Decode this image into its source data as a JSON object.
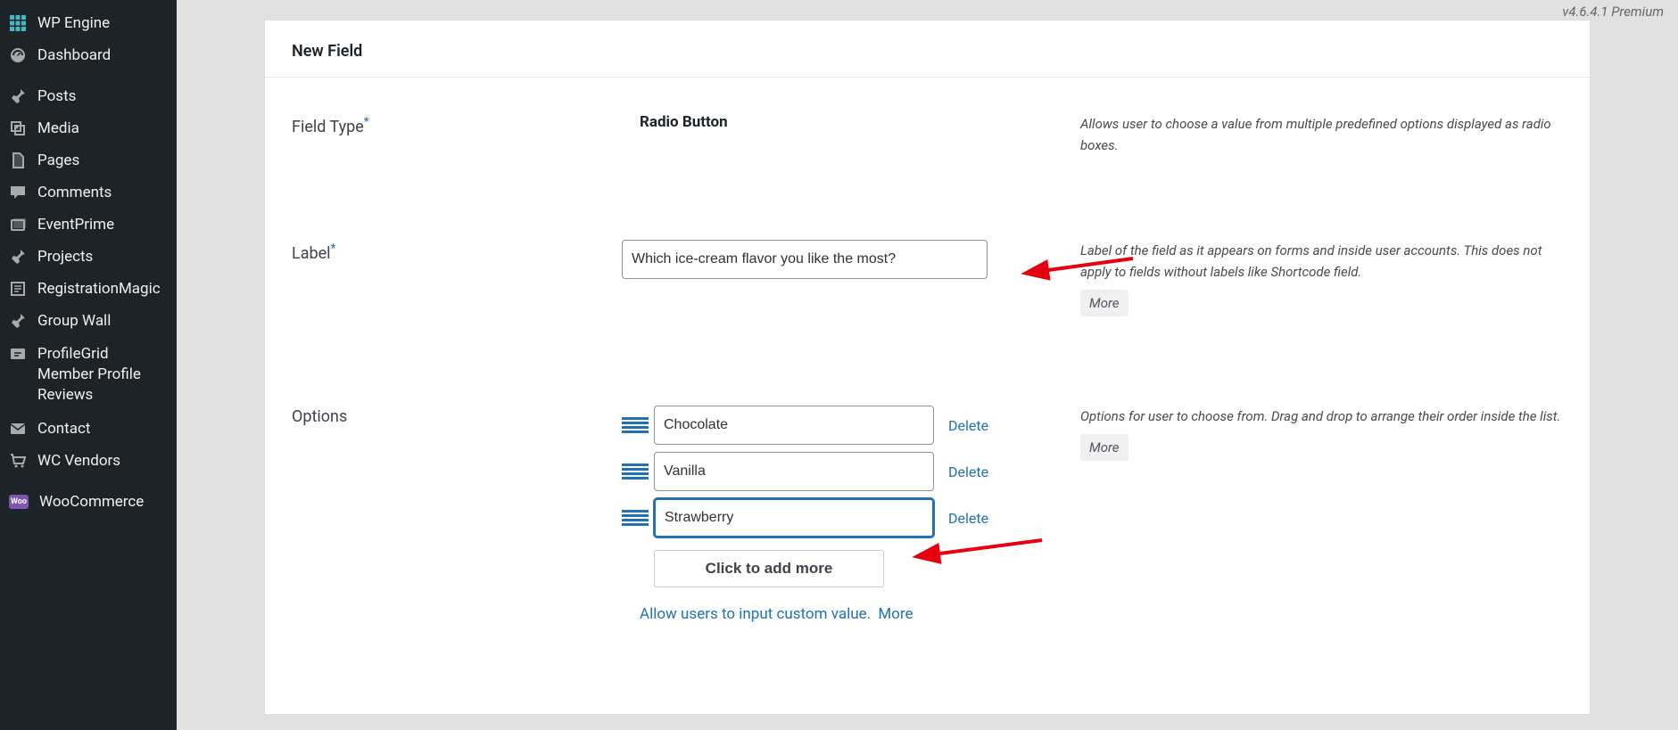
{
  "version": "v4.6.4.1 Premium",
  "sidebar": {
    "items": [
      {
        "label": "WP Engine",
        "icon": "wpengine"
      },
      {
        "label": "Dashboard",
        "icon": "gauge"
      },
      {
        "label": "Posts",
        "icon": "pin"
      },
      {
        "label": "Media",
        "icon": "media"
      },
      {
        "label": "Pages",
        "icon": "page"
      },
      {
        "label": "Comments",
        "icon": "comment"
      },
      {
        "label": "EventPrime",
        "icon": "calendar-stack"
      },
      {
        "label": "Projects",
        "icon": "pin"
      },
      {
        "label": "RegistrationMagic",
        "icon": "form"
      },
      {
        "label": "Group Wall",
        "icon": "pin"
      },
      {
        "label": "ProfileGrid Member Profile Reviews",
        "icon": "review-box"
      },
      {
        "label": "Contact",
        "icon": "envelope"
      },
      {
        "label": "WC Vendors",
        "icon": "cart"
      },
      {
        "label": "WooCommerce",
        "icon": "woo"
      }
    ]
  },
  "panel": {
    "title": "New Field",
    "fieldType": {
      "label": "Field Type",
      "value": "Radio Button",
      "help": "Allows user to choose a value from multiple predefined options displayed as radio boxes."
    },
    "labelField": {
      "label": "Label",
      "value": "Which ice-cream flavor you like the most?",
      "help": "Label of the field as it appears on forms and inside user accounts. This does not apply to fields without labels like Shortcode field.",
      "more": "More"
    },
    "options": {
      "label": "Options",
      "items": [
        {
          "value": "Chocolate",
          "delete": "Delete"
        },
        {
          "value": "Vanilla",
          "delete": "Delete"
        },
        {
          "value": "Strawberry",
          "delete": "Delete",
          "focused": true
        }
      ],
      "addMore": "Click to add more",
      "customValue": "Allow users to input custom value.",
      "customValueMore": "More",
      "help": "Options for user to choose from. Drag and drop to arrange their order inside the list.",
      "more": "More"
    }
  }
}
